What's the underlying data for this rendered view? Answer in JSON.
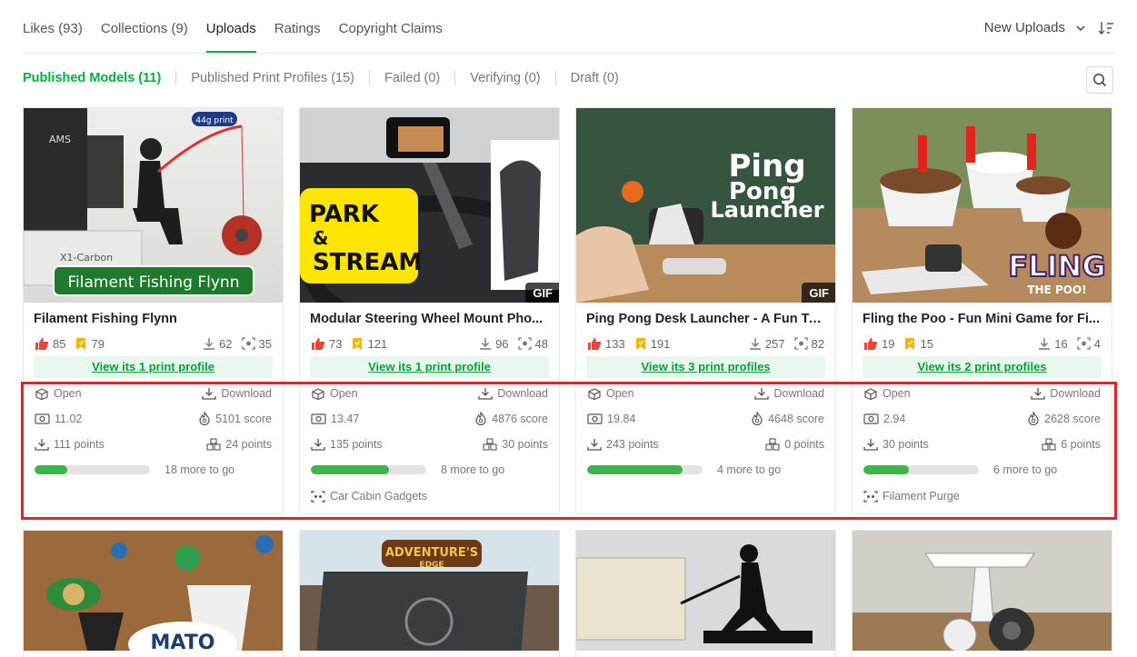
{
  "tabs": [
    "Likes (93)",
    "Collections (9)",
    "Uploads",
    "Ratings",
    "Copyright Claims"
  ],
  "active_tab": "Uploads",
  "sort": {
    "label": "New Uploads"
  },
  "subtabs": [
    "Published Models (11)",
    "Published Print Profiles (15)",
    "Failed (0)",
    "Verifying (0)",
    "Draft (0)"
  ],
  "cards": [
    {
      "title": "Filament Fishing Flynn",
      "likes": "85",
      "collects": "79",
      "downloads": "62",
      "prints": "35",
      "print_profile_link": "View its 1 print profile",
      "open": "Open",
      "download": "Download",
      "price": "11.02",
      "score": "5101 score",
      "points": "111 points",
      "print_points": "24 points",
      "progress": 0.28,
      "more_to_go": "18 more to go",
      "collection": "",
      "gif": "",
      "thumb_text": "Filament Fishing Flynn",
      "thumb_badge": "44g print",
      "thumb_brand": "AMS",
      "thumb_brand2": "X1-Carbon"
    },
    {
      "title": "Modular Steering Wheel Mount Pho...",
      "likes": "73",
      "collects": "121",
      "downloads": "96",
      "prints": "48",
      "print_profile_link": "View its 1 print profile",
      "open": "Open",
      "download": "Download",
      "price": "13.47",
      "score": "4876 score",
      "points": "135 points",
      "print_points": "30 points",
      "progress": 0.68,
      "more_to_go": "8 more to go",
      "collection": "Car Cabin Gadgets",
      "gif": "GIF",
      "thumb_text": "PARK & STREAM"
    },
    {
      "title": "Ping Pong Desk Launcher - A Fun To...",
      "likes": "133",
      "collects": "191",
      "downloads": "257",
      "prints": "82",
      "print_profile_link": "View its 3 print profiles",
      "open": "Open",
      "download": "Download",
      "price": "19.84",
      "score": "4648 score",
      "points": "243 points",
      "print_points": "0 points",
      "progress": 0.83,
      "more_to_go": "4 more to go",
      "collection": "",
      "gif": "GIF",
      "thumb_text": "Ping Pong Launcher"
    },
    {
      "title": "Fling the Poo - Fun Mini Game for Fi...",
      "likes": "19",
      "collects": "15",
      "downloads": "16",
      "prints": "4",
      "print_profile_link": "View its 2 print profiles",
      "open": "Open",
      "download": "Download",
      "price": "2.94",
      "score": "2628 score",
      "points": "30 points",
      "print_points": "6 points",
      "progress": 0.39,
      "more_to_go": "6 more to go",
      "collection": "Filament Purge",
      "gif": "",
      "thumb_text": "FLING",
      "thumb_text2": "THE POO!"
    }
  ],
  "bottom_row_thumbs": [
    {
      "thumb_text": "MATO"
    },
    {
      "thumb_text": "ADVENTURE'S",
      "thumb_text2": "EDGE"
    },
    {
      "thumb_text": ""
    },
    {
      "thumb_text": ""
    }
  ],
  "colors": {
    "accent": "#00ae42",
    "like": "#e8453c",
    "collect": "#f5b400",
    "highlight": "#e0242c",
    "progress": "#3cb54a"
  }
}
